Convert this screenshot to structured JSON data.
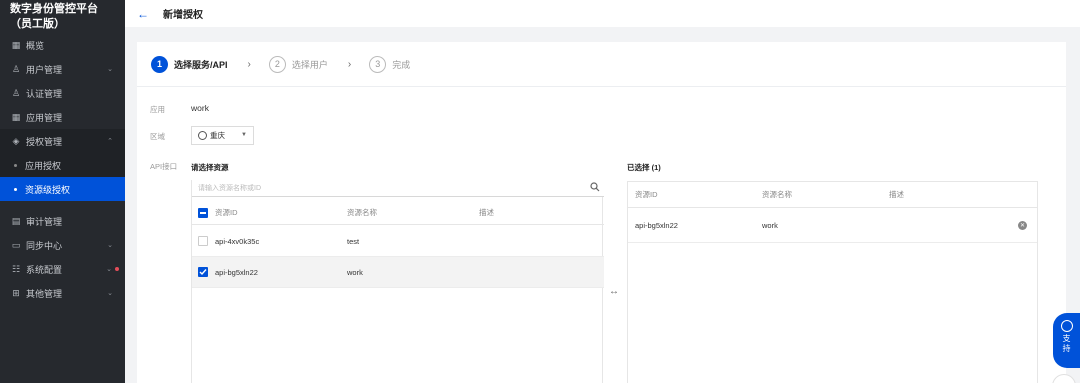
{
  "app": {
    "title": "数字身份管控平台（员工版）"
  },
  "sidebar": {
    "items": [
      {
        "label": "概览",
        "icon": "grid-icon"
      },
      {
        "label": "用户管理",
        "icon": "user-icon"
      },
      {
        "label": "认证管理",
        "icon": "person-icon"
      },
      {
        "label": "应用管理",
        "icon": "apps-icon"
      },
      {
        "label": "授权管理",
        "icon": "shield-icon"
      },
      {
        "label": "应用授权"
      },
      {
        "label": "资源级授权"
      },
      {
        "label": "审计管理",
        "icon": "doc-icon"
      },
      {
        "label": "同步中心",
        "icon": "monitor-icon"
      },
      {
        "label": "系统配置",
        "icon": "settings-icon"
      },
      {
        "label": "其他管理",
        "icon": "box-icon"
      }
    ]
  },
  "header": {
    "title": "新增授权"
  },
  "steps": [
    {
      "num": "1",
      "label": "选择服务/API"
    },
    {
      "num": "2",
      "label": "选择用户"
    },
    {
      "num": "3",
      "label": "完成"
    }
  ],
  "form": {
    "app_label": "应用",
    "app_value": "work",
    "region_label": "区域",
    "region_value": "重庆",
    "api_label": "API接口"
  },
  "left_panel": {
    "title": "请选择资源",
    "search_placeholder": "请输入资源名称或ID",
    "columns": [
      "资源ID",
      "资源名称",
      "描述"
    ],
    "rows": [
      {
        "id": "api-4xv0k35c",
        "name": "test",
        "desc": "",
        "checked": false
      },
      {
        "id": "api-bg5xln22",
        "name": "work",
        "desc": "",
        "checked": true
      }
    ]
  },
  "right_panel": {
    "title": "已选择 (1)",
    "columns": [
      "资源ID",
      "资源名称",
      "描述"
    ],
    "rows": [
      {
        "id": "api-bg5xln22",
        "name": "work",
        "desc": ""
      }
    ]
  },
  "transfer_icon": "↔",
  "support": {
    "line1": "支",
    "line2": "持"
  },
  "colors": {
    "primary": "#0052d9",
    "sidebar_bg": "#26292e"
  }
}
